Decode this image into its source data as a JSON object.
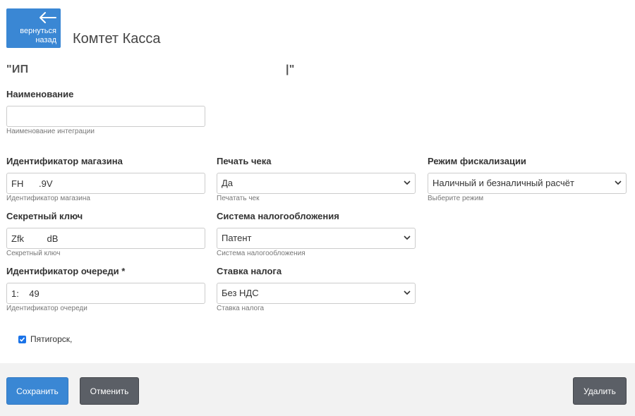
{
  "header": {
    "back_label_line1": "вернуться",
    "back_label_line2": "назад",
    "title": "Комтет Касса",
    "org_name_start": "\"ИП",
    "org_name_end": "|\""
  },
  "fields": {
    "name": {
      "label": "Наименование",
      "value": "",
      "help": "Наименование интеграции"
    },
    "shop_id": {
      "label": "Идентификатор магазина",
      "value": "FH      .9V",
      "help": "Идентификатор магазина"
    },
    "secret_key": {
      "label": "Секретный ключ",
      "value": "Zfk         dB",
      "help": "Секретный ключ"
    },
    "queue_id": {
      "label": "Идентификатор очереди *",
      "value": "1:    49",
      "help": "Идентификатор очереди"
    },
    "print_check": {
      "label": "Печать чека",
      "value": "Да",
      "help": "Печатать чек"
    },
    "tax_system": {
      "label": "Система налогообложения",
      "value": "Патент",
      "help": "Система налогообложения"
    },
    "tax_rate": {
      "label": "Ставка налога",
      "value": "Без НДС",
      "help": "Ставка налога"
    },
    "fiscal_mode": {
      "label": "Режим фискализации",
      "value": "Наличный и безналичный расчёт",
      "help": "Выберите режим"
    }
  },
  "checkbox": {
    "label": "Пятигорск,",
    "checked": true
  },
  "footer": {
    "save_label": "Сохранить",
    "cancel_label": "Отменить",
    "delete_label": "Удалить"
  },
  "colors": {
    "primary": "#3a87d4",
    "secondary": "#5b5f66",
    "footer_bg": "#f2f2f2"
  },
  "icons": {
    "back": "arrow-left-icon",
    "select": "chevron-down-icon",
    "check": "check-icon"
  }
}
